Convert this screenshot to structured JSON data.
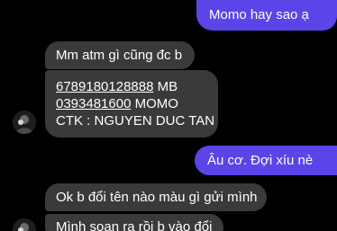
{
  "chat": {
    "messages": [
      {
        "sender": "me",
        "text": "Momo hay sao ạ"
      },
      {
        "sender": "contact",
        "text": "Mm atm gì cũng đc b"
      },
      {
        "sender": "contact",
        "lines": [
          {
            "number": "6789180128888",
            "rest": " MB"
          },
          {
            "number": "0393481600",
            "rest": " MOMO"
          },
          {
            "number": "",
            "rest": "CTK : NGUYEN DUC TAN"
          }
        ]
      },
      {
        "sender": "me",
        "text": "Âu cơ. Đợi xíu nè"
      },
      {
        "sender": "contact",
        "text": "Ok b đổi tên nào màu gì gửi mình"
      },
      {
        "sender": "contact",
        "text": "Mình soạn ra rồi b vào đổi"
      }
    ]
  },
  "colors": {
    "outgoing_bubble": "#5b44e8",
    "incoming_bubble": "#3a3a3c",
    "background": "#000000"
  },
  "icons": {
    "avatar": "contact-avatar-icon"
  }
}
